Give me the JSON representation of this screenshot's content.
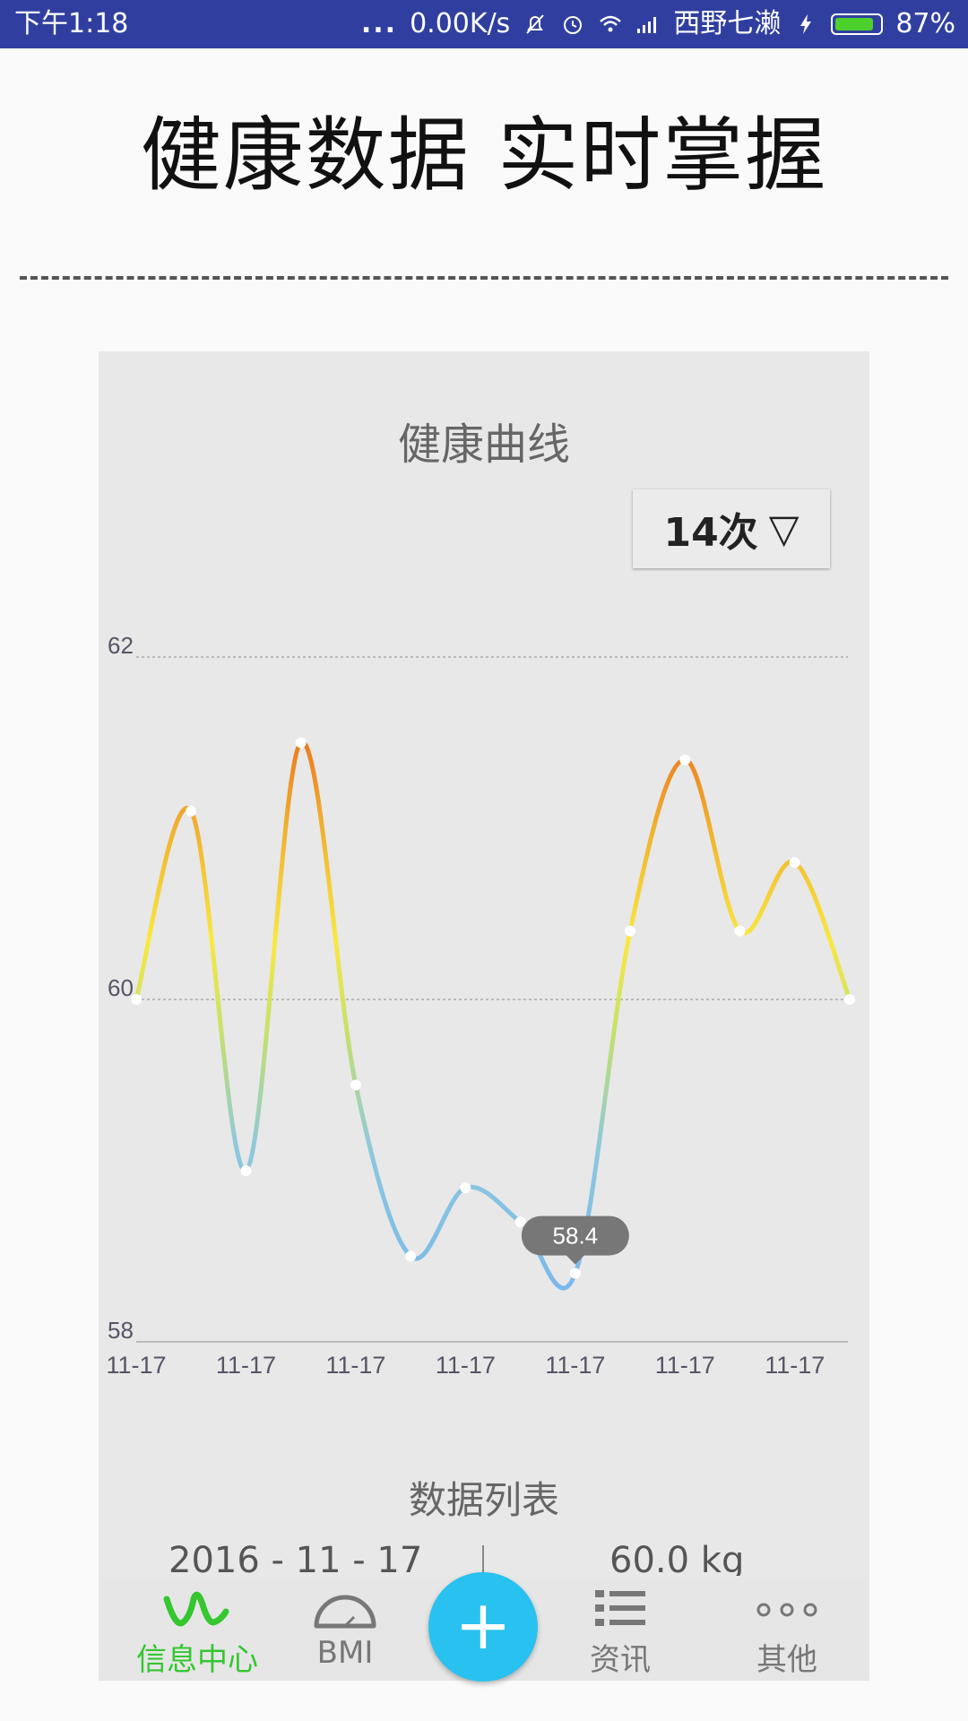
{
  "status_bar": {
    "time": "下午1:18",
    "dots": "...",
    "net_speed": "0.00K/s",
    "carrier": "西野七濑",
    "battery": "87%",
    "battery_level": 0.87,
    "icons": [
      "mute-icon",
      "alarm-icon",
      "wifi-icon",
      "signal-icon",
      "charging-icon",
      "battery-icon"
    ]
  },
  "headline": "健康数据 实时掌握",
  "card": {
    "title": "健康曲线",
    "dropdown_label": "14次",
    "dropdown_caret": "▽"
  },
  "chart_data": {
    "type": "line",
    "title": "健康曲线",
    "y_ticks": [
      "62",
      "60",
      "58"
    ],
    "ylim": [
      58,
      62
    ],
    "grid": true,
    "x_tick_labels": [
      "11-17",
      "11-17",
      "11-17",
      "11-17",
      "11-17",
      "11-17",
      "11-17"
    ],
    "series": [
      {
        "values": [
          60.0,
          61.1,
          59.0,
          61.5,
          59.5,
          58.5,
          58.9,
          58.7,
          58.4,
          60.4,
          61.4,
          60.4,
          60.8,
          60.0
        ]
      }
    ],
    "tooltip": {
      "index": 8,
      "text": "58.4"
    },
    "colors": {
      "low": "#7ab8ea",
      "mid": "#f8e840",
      "high": "#e8701e"
    }
  },
  "list": {
    "title": "数据列表",
    "rows": [
      {
        "date": "2016 - 11 - 17",
        "value": "60.0  kg"
      }
    ]
  },
  "bottom_nav": {
    "items": [
      {
        "label": "信息中心",
        "icon": "wave-icon",
        "active": true
      },
      {
        "label": "BMI",
        "icon": "gauge-icon",
        "active": false
      },
      {
        "label": "资讯",
        "icon": "list-icon",
        "active": false
      },
      {
        "label": "其他",
        "icon": "more-icon",
        "active": false
      }
    ],
    "fab_label": "+"
  },
  "accent_color": "#35c630",
  "status_bar_color": "#303f9f",
  "fab_color": "#29c1ef"
}
